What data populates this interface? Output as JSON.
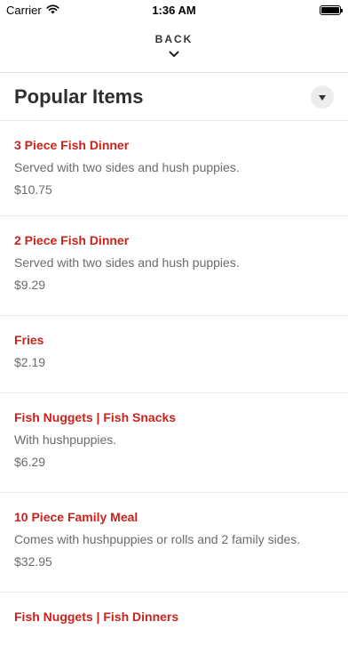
{
  "status": {
    "carrier": "Carrier",
    "time": "1:36 AM"
  },
  "nav": {
    "back_label": "BACK"
  },
  "section": {
    "title": "Popular Items"
  },
  "items": [
    {
      "name": "3 Piece Fish Dinner",
      "description": "Served with two sides and hush puppies.",
      "price": "$10.75"
    },
    {
      "name": "2 Piece Fish Dinner",
      "description": "Served with two sides and hush puppies.",
      "price": "$9.29"
    },
    {
      "name": "Fries",
      "description": "",
      "price": "$2.19"
    },
    {
      "name": "Fish Nuggets | Fish Snacks",
      "description": "With hushpuppies.",
      "price": "$6.29"
    },
    {
      "name": "10 Piece Family Meal",
      "description": "Comes with hushpuppies or rolls and 2 family sides.",
      "price": "$32.95"
    },
    {
      "name": "Fish Nuggets | Fish Dinners",
      "description": "",
      "price": ""
    }
  ]
}
